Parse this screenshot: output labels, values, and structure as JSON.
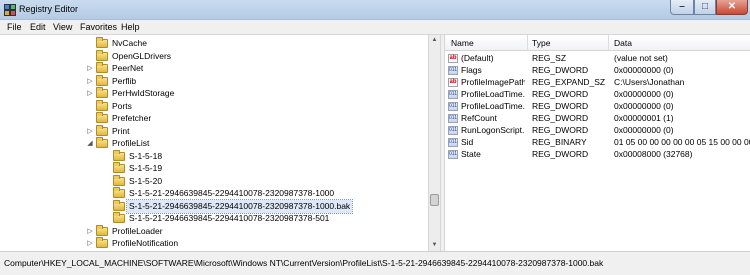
{
  "window": {
    "title": "Registry Editor",
    "min_glyph": "–",
    "max_glyph": "□",
    "close_glyph": "✕"
  },
  "menu": [
    "File",
    "Edit",
    "View",
    "Favorites",
    "Help"
  ],
  "tree": [
    {
      "label": "NvCache",
      "expander": ""
    },
    {
      "label": "OpenGLDrivers",
      "expander": ""
    },
    {
      "label": "PeerNet",
      "expander": "▷"
    },
    {
      "label": "Perflib",
      "expander": "▷"
    },
    {
      "label": "PerHwIdStorage",
      "expander": "▷"
    },
    {
      "label": "Ports",
      "expander": ""
    },
    {
      "label": "Prefetcher",
      "expander": ""
    },
    {
      "label": "Print",
      "expander": "▷"
    },
    {
      "label": "ProfileList",
      "expander": "◢"
    },
    {
      "label": "S-1-5-18",
      "expander": ""
    },
    {
      "label": "S-1-5-19",
      "expander": ""
    },
    {
      "label": "S-1-5-20",
      "expander": ""
    },
    {
      "label": "S-1-5-21-2946639845-2294410078-2320987378-1000",
      "expander": ""
    },
    {
      "label": "S-1-5-21-2946639845-2294410078-2320987378-1000.bak",
      "expander": "",
      "selected": true
    },
    {
      "label": "S-1-5-21-2946639845-2294410078-2320987378-501",
      "expander": ""
    },
    {
      "label": "ProfileLoader",
      "expander": "▷"
    },
    {
      "label": "ProfileNotification",
      "expander": "▷"
    }
  ],
  "columns": {
    "name": "Name",
    "type": "Type",
    "data": "Data"
  },
  "values": [
    {
      "name": "(Default)",
      "type": "REG_SZ",
      "data": "(value not set)",
      "icon": "ab"
    },
    {
      "name": "Flags",
      "type": "REG_DWORD",
      "data": "0x00000000 (0)",
      "icon": "bin"
    },
    {
      "name": "ProfileImagePath",
      "type": "REG_EXPAND_SZ",
      "data": "C:\\Users\\Jonathan",
      "icon": "ab"
    },
    {
      "name": "ProfileLoadTime...",
      "type": "REG_DWORD",
      "data": "0x00000000 (0)",
      "icon": "bin"
    },
    {
      "name": "ProfileLoadTime...",
      "type": "REG_DWORD",
      "data": "0x00000000 (0)",
      "icon": "bin"
    },
    {
      "name": "RefCount",
      "type": "REG_DWORD",
      "data": "0x00000001 (1)",
      "icon": "bin"
    },
    {
      "name": "RunLogonScript...",
      "type": "REG_DWORD",
      "data": "0x00000000 (0)",
      "icon": "bin"
    },
    {
      "name": "Sid",
      "type": "REG_BINARY",
      "data": "01 05 00 00 00 00 00 05 15 00 00 00 e",
      "icon": "bin"
    },
    {
      "name": "State",
      "type": "REG_DWORD",
      "data": "0x00008000 (32768)",
      "icon": "bin"
    }
  ],
  "status": "Computer\\HKEY_LOCAL_MACHINE\\SOFTWARE\\Microsoft\\Windows NT\\CurrentVersion\\ProfileList\\S-1-5-21-2946639845-2294410078-2320987378-1000.bak"
}
